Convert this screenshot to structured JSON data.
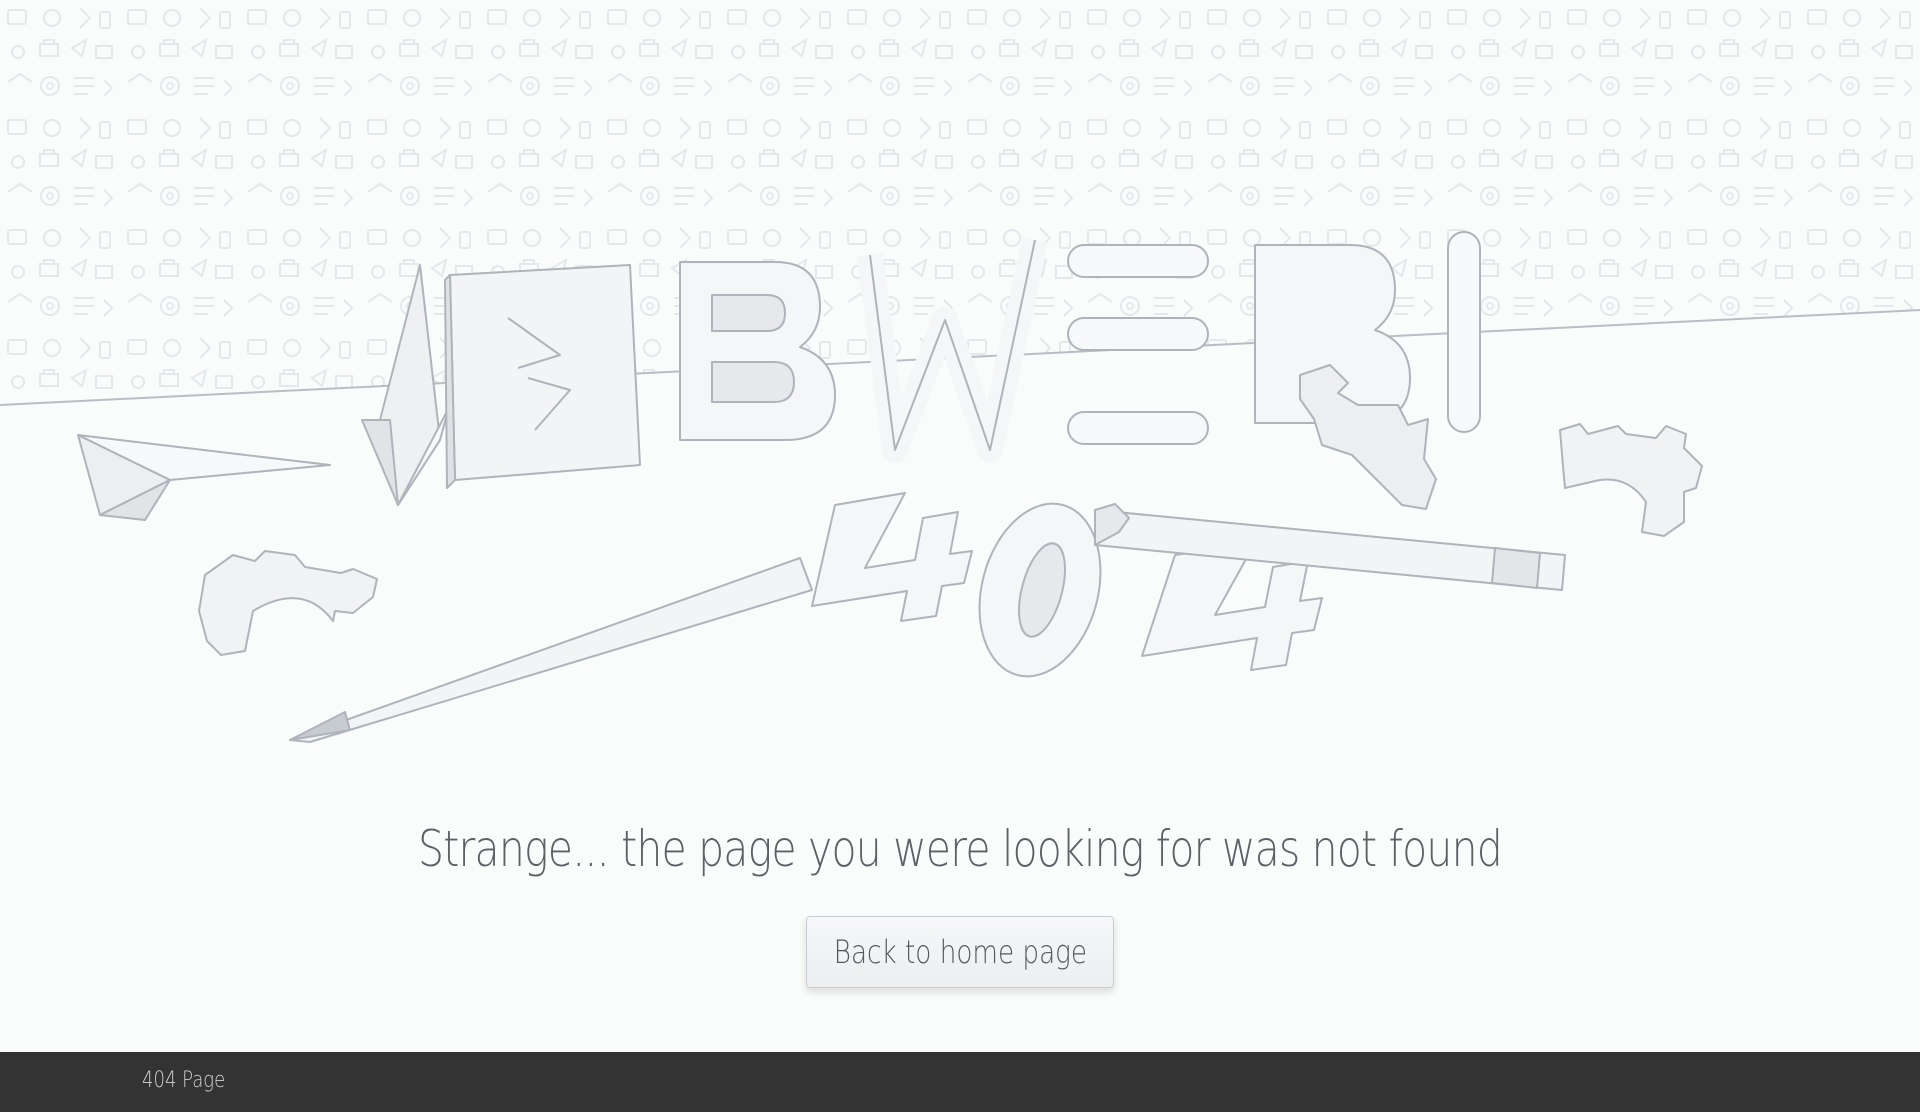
{
  "illustration": {
    "brand": "BWEB",
    "code": "404"
  },
  "main": {
    "message": "Strange... the page you were looking for was not found",
    "home_button_label": "Back to home page"
  },
  "footer": {
    "label": "404 Page"
  },
  "colors": {
    "background": "#fafbfb",
    "line": "#b9bec4",
    "footer": "#333333"
  }
}
